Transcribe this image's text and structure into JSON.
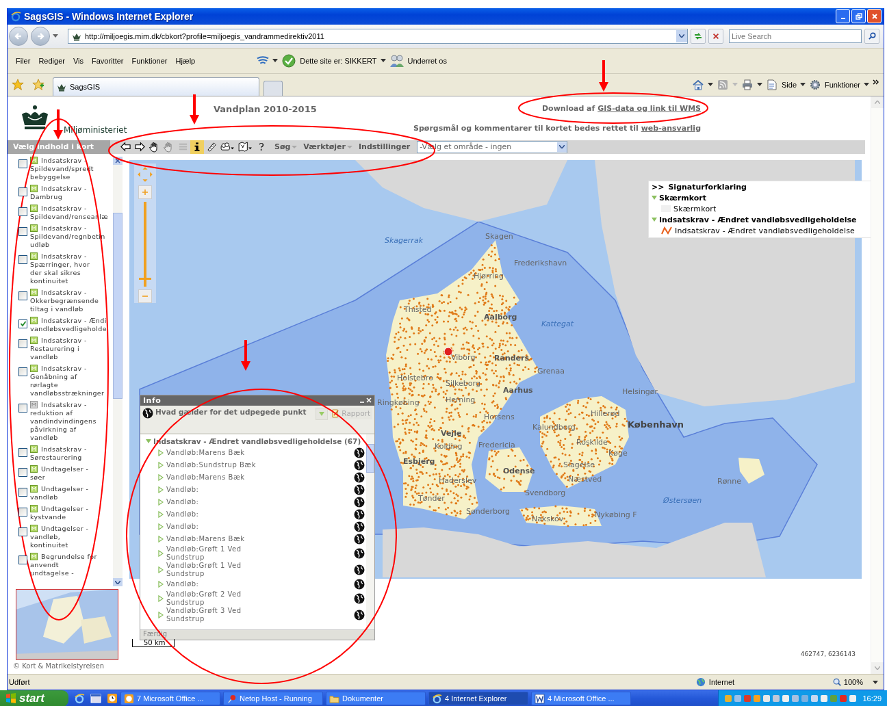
{
  "window": {
    "title": "SagsGIS - Windows Internet Explorer"
  },
  "address_bar": {
    "url": "http://miljoegis.mim.dk/cbkort?profile=miljoegis_vandrammedirektiv2011",
    "search_placeholder": "Live Search"
  },
  "menu": [
    "Filer",
    "Rediger",
    "Vis",
    "Favoritter",
    "Funktioner",
    "Hjælp"
  ],
  "security_toolbar": {
    "status": "Dette site er: SIKKERT",
    "notify": "Underret os"
  },
  "tabs": [
    {
      "label": "SagsGIS",
      "selected": true
    }
  ],
  "command_bar": [
    "Side",
    "Funktioner"
  ],
  "page": {
    "org": "Miljøministeriet",
    "title": "Vandplan 2010-2015",
    "download": {
      "text": "Download af ",
      "link": "GIS-data og link til WMS"
    },
    "contact": {
      "text": "Spørgsmål og kommentarer til kortet bedes rettet til ",
      "link": "web-ansvarlig"
    }
  },
  "layer_panel": {
    "title": "Vælg indhold i kort",
    "layers": [
      {
        "label": "Indsatskrav -\nSpildevand/spredt\nbebyggelse",
        "checked": false,
        "available": true
      },
      {
        "label": "Indsatskrav -\nDambrug",
        "checked": false,
        "available": true
      },
      {
        "label": "Indsatskrav -\nSpildevand/renseanlæ",
        "checked": false,
        "available": true
      },
      {
        "label": "Indsatskrav -\nSpildevand/regnbetin\nudløb",
        "checked": false,
        "available": true
      },
      {
        "label": "Indsatskrav -\nSpærringer, hvor\nder skal sikres\nkontinuitet",
        "checked": false,
        "available": true
      },
      {
        "label": "Indsatskrav -\nOkkerbegrænsende\ntiltag i vandløb",
        "checked": false,
        "available": true
      },
      {
        "label": "Indsatskrav - Ændi\nvandløbsvedligeholde",
        "checked": true,
        "available": true
      },
      {
        "label": "Indsatskrav -\nRestaurering i\nvandløb",
        "checked": false,
        "available": true
      },
      {
        "label": "Indsatskrav -\nGenåbning af\nrørlagte\nvandløbsstrækninger",
        "checked": false,
        "available": true
      },
      {
        "label": "Indsatskrav -\nreduktion af\nvandindvindingens\npåvirkning af\nvandløb",
        "checked": false,
        "available": false
      },
      {
        "label": "Indsatskrav -\nSørestaurering",
        "checked": false,
        "available": true
      },
      {
        "label": "Undtagelser -\nsøer",
        "checked": false,
        "available": true
      },
      {
        "label": "Undtagelser -\nvandløb",
        "checked": false,
        "available": true
      },
      {
        "label": "Undtagelser -\nkystvande",
        "checked": false,
        "available": true
      },
      {
        "label": "Undtagelser -\nvandløb,\nkontinuitet",
        "checked": false,
        "available": true
      },
      {
        "label": "Begrundelse for\nanvendt\nundtagelse -",
        "checked": false,
        "available": true
      }
    ]
  },
  "toolbar": {
    "tools": [
      {
        "kind": "back",
        "selected": false,
        "disabled": false
      },
      {
        "kind": "forward",
        "selected": false,
        "disabled": false
      },
      {
        "kind": "pan",
        "selected": false,
        "disabled": false
      },
      {
        "kind": "pan",
        "selected": false,
        "disabled": true
      },
      {
        "kind": "list",
        "selected": false,
        "disabled": true
      },
      {
        "kind": "info",
        "selected": true,
        "disabled": false
      },
      {
        "kind": "ruler",
        "selected": false,
        "disabled": false
      },
      {
        "kind": "print",
        "selected": false,
        "disabled": false
      },
      {
        "kind": "map",
        "selected": false,
        "disabled": false
      },
      {
        "kind": "help",
        "selected": false,
        "disabled": false,
        "label": "?"
      }
    ],
    "menus": [
      {
        "label": "Søg",
        "dropdown": true
      },
      {
        "label": "Værktøjer",
        "dropdown": true
      },
      {
        "label": "Indstillinger",
        "dropdown": false
      }
    ]
  },
  "area_select": {
    "value": "-Vælg et område - ingen"
  },
  "map": {
    "zoom_slider": {
      "level": 0.08
    },
    "labels": [
      {
        "text": "Skagen",
        "kind": "town"
      },
      {
        "text": "Skagerrak",
        "kind": "sea"
      },
      {
        "text": "Frederikshavn",
        "kind": "town"
      },
      {
        "text": "Hjørring",
        "kind": "town"
      },
      {
        "text": "Thisted",
        "kind": "town"
      },
      {
        "text": "Aalborg",
        "kind": "city"
      },
      {
        "text": "Kattegat",
        "kind": "sea"
      },
      {
        "text": "Viborg",
        "kind": "town"
      },
      {
        "text": "Randers",
        "kind": "city"
      },
      {
        "text": "Grenaa",
        "kind": "town"
      },
      {
        "text": "Holstebro",
        "kind": "town"
      },
      {
        "text": "Silkeborg",
        "kind": "town"
      },
      {
        "text": "Aarhus",
        "kind": "city"
      },
      {
        "text": "Helsingør",
        "kind": "town"
      },
      {
        "text": "Herning",
        "kind": "town"
      },
      {
        "text": "Ringkøbing",
        "kind": "town"
      },
      {
        "text": "Hillerød",
        "kind": "town"
      },
      {
        "text": "Horsens",
        "kind": "town"
      },
      {
        "text": "København",
        "kind": "capital"
      },
      {
        "text": "Kalundborg",
        "kind": "town"
      },
      {
        "text": "Vejle",
        "kind": "city"
      },
      {
        "text": "Roskilde",
        "kind": "town"
      },
      {
        "text": "Kolding",
        "kind": "town"
      },
      {
        "text": "Fredericia",
        "kind": "town"
      },
      {
        "text": "Køge",
        "kind": "town"
      },
      {
        "text": "Esbjerg",
        "kind": "city"
      },
      {
        "text": "Slagelse",
        "kind": "town"
      },
      {
        "text": "Odense",
        "kind": "city"
      },
      {
        "text": "Haderslev",
        "kind": "town"
      },
      {
        "text": "Næstved",
        "kind": "town"
      },
      {
        "text": "Rønne",
        "kind": "town"
      },
      {
        "text": "Svendborg",
        "kind": "town"
      },
      {
        "text": "Tønder",
        "kind": "town"
      },
      {
        "text": "Østersøen",
        "kind": "sea"
      },
      {
        "text": "Sønderborg",
        "kind": "town"
      },
      {
        "text": "Nykøbing F",
        "kind": "town"
      },
      {
        "text": "Nakskov",
        "kind": "town"
      }
    ],
    "coordinates": "462747, 6236143",
    "scale": "50 km",
    "copyright": "© Kort & Matrikelstyrelsen"
  },
  "legend": {
    "toggle": ">>",
    "title": "Signaturforklaring",
    "groups": [
      {
        "name": "Skærmkort",
        "expanded": true,
        "items": [
          {
            "label": "Skærmkort",
            "kind": "swatch"
          }
        ]
      },
      {
        "name": "Indsatskrav - Ændret vandløbsvedligeholdelse",
        "expanded": true,
        "items": [
          {
            "label": "Indsatskrav - Ændret vandløbsvedligeholdelse",
            "kind": "line"
          }
        ]
      }
    ]
  },
  "info_panel": {
    "title": "Info",
    "question": "Hvad gælder for det udpegede punkt",
    "report": "Rapport",
    "group": {
      "label": "Indsatskrav - Ændret vandløbsvedligeholdelse (67)",
      "expanded": true
    },
    "results": [
      "Vandløb:Marens Bæk",
      "Vandløb:Sundstrup Bæk",
      "Vandløb:Marens Bæk",
      "Vandløb:",
      "Vandløb:",
      "Vandløb:",
      "Vandløb:",
      "Vandløb:Marens Bæk",
      "Vandløb:Grøft 1 Ved\nSundstrup",
      "Vandløb:Grøft 1 Ved\nSundstrup",
      "Vandløb:",
      "Vandløb:Grøft 2 Ved\nSundstrup",
      "Vandløb:Grøft 3 Ved\nSundstrup"
    ],
    "status": "Færdig"
  },
  "status_bar": {
    "text": "Udført",
    "zone": "Internet",
    "zoom": "100%"
  },
  "taskbar": {
    "start": "start",
    "buttons": [
      {
        "label": "7 Microsoft Office ...",
        "selected": false,
        "kind": "office"
      },
      {
        "label": "Netop Host - Running",
        "selected": false,
        "kind": "pin"
      },
      {
        "label": "Dokumenter",
        "selected": false,
        "kind": "folder"
      },
      {
        "label": "4 Internet Explorer",
        "selected": true,
        "kind": "ie"
      },
      {
        "label": "4 Microsoft Office ...",
        "selected": false,
        "kind": "word"
      }
    ],
    "clock": "16:29"
  }
}
